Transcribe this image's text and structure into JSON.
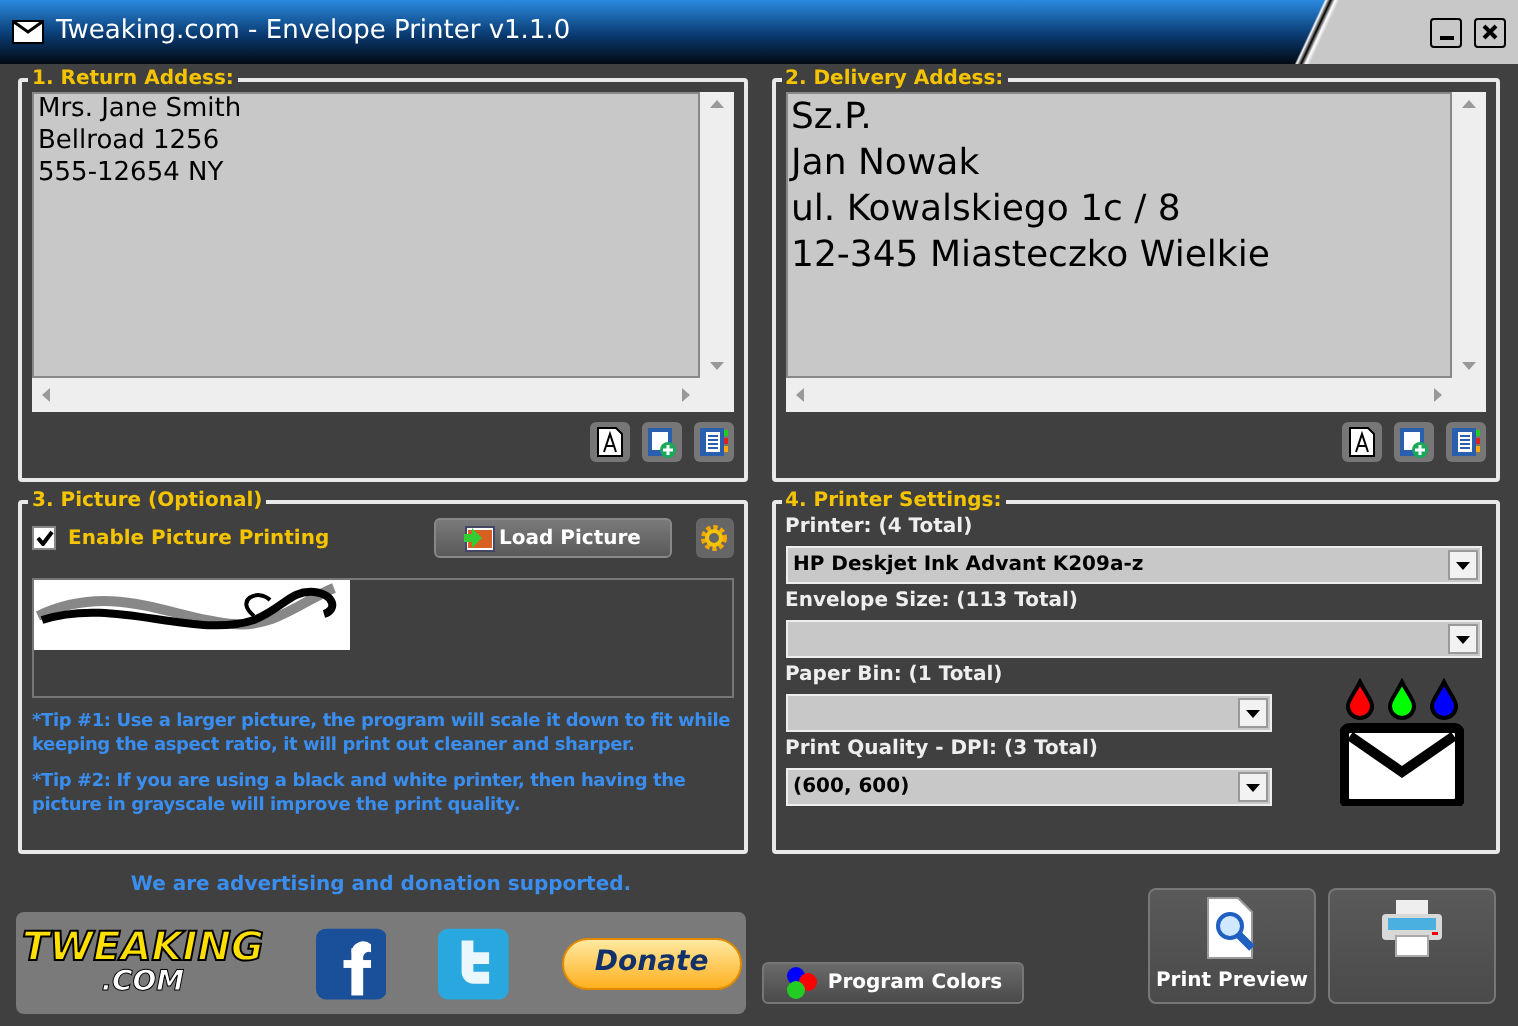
{
  "window": {
    "title": "Tweaking.com - Envelope Printer v1.1.0"
  },
  "return_address": {
    "legend": "1. Return Addess:",
    "lines": [
      "Mrs. Jane Smith",
      "Bellroad 1256",
      "555-12654 NY"
    ]
  },
  "delivery_address": {
    "legend": "2. Delivery Addess:",
    "lines": [
      "Sz.P.",
      "Jan Nowak",
      "ul. Kowalskiego 1c / 8",
      "12-345 Miasteczko Wielkie"
    ]
  },
  "picture": {
    "legend": "3. Picture (Optional)",
    "enable": {
      "label": "Enable Picture Printing",
      "checked": true
    },
    "load_button": "Load Picture",
    "tips": [
      "*Tip #1: Use a larger picture, the program will scale it down to fit while keeping the aspect ratio, it will print out cleaner and sharper.",
      "*Tip #2: If you are using a black and white printer, then having the picture in grayscale will improve the print quality."
    ]
  },
  "printer_settings": {
    "legend": "4. Printer Settings:",
    "fields": [
      {
        "label": "Printer: (4 Total)",
        "value": "HP Deskjet Ink Advant K209a-z",
        "kind": "wide"
      },
      {
        "label": "Envelope Size: (113 Total)",
        "kind": "wide"
      },
      {
        "label": "Paper Bin: (1 Total)",
        "kind": "narrow"
      },
      {
        "label": "Print Quality - DPI: (3 Total)",
        "value": "(600, 600)",
        "kind": "narrow"
      }
    ]
  },
  "footer": {
    "support_note": "We are advertising and donation supported.",
    "logo": {
      "line_1": "TWEAKING",
      "line_2": ".COM"
    },
    "donate_button": "Donate",
    "program_colors_button": "Program Colors",
    "print_preview_button": "Print Preview"
  }
}
